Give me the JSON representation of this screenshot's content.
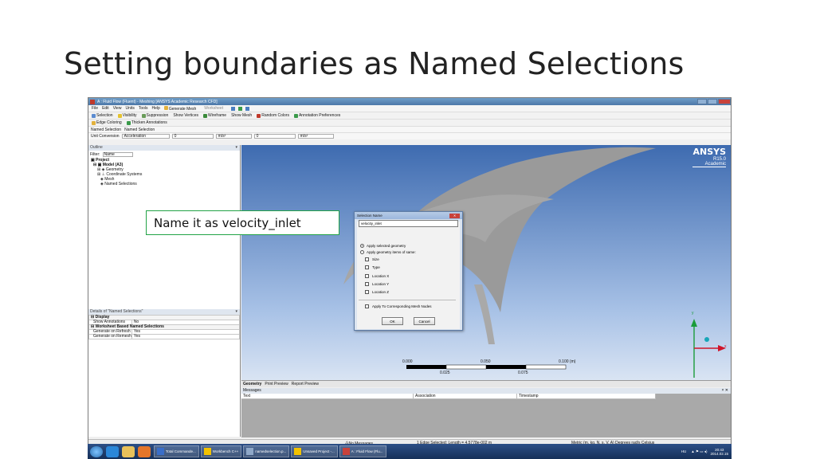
{
  "slide": {
    "title": "Setting boundaries as Named Selections"
  },
  "app": {
    "window_title": "A : Fluid Flow (Fluent) - Meshing [ANSYS Academic Research CFD]",
    "menu": [
      "File",
      "Edit",
      "View",
      "Units",
      "Tools",
      "Help"
    ],
    "toolbar1": [
      "Generate Mesh",
      "Worksheet"
    ],
    "toolbar2": [
      "Selection",
      "Visibility",
      "Suppression",
      "Show Vertices",
      "Wireframe",
      "Show Mesh",
      "Random Colors",
      "Annotation Preferences"
    ],
    "toolbar3": [
      "Edge Coloring",
      "Thicken Annotations"
    ],
    "named_selection_bar": [
      "Named Selection",
      "Named Selection"
    ],
    "unit_conversion": {
      "label": "Unit Conversion",
      "quantity": "Acceleration",
      "value1": "0",
      "unit1": "m/s²",
      "value2": "0",
      "unit2": "m/s²"
    }
  },
  "outline": {
    "header": "Outline",
    "filter_label": "Filter:",
    "filter_value": "Name",
    "tree": [
      "Project",
      "Model (A3)",
      "Geometry",
      "Coordinate Systems",
      "Mesh",
      "Named Selections"
    ]
  },
  "details": {
    "header": "Details of \"Named Selections\"",
    "rows": [
      {
        "name": "Display",
        "value": "",
        "group": true
      },
      {
        "name": "Show Annotations",
        "value": "No",
        "group": false
      },
      {
        "name": "Worksheet Based Named Selections",
        "value": "",
        "group": true
      },
      {
        "name": "Generate on Refresh",
        "value": "Yes",
        "group": false
      },
      {
        "name": "Generate on Remesh",
        "value": "Yes",
        "group": false
      }
    ]
  },
  "viewport": {
    "brand": "ANSYS",
    "release": "R15.0",
    "edition": "Academic",
    "axis_x": "x",
    "axis_y": "y",
    "scale_top": [
      "0.000",
      "0.050",
      "0.100 (m)"
    ],
    "scale_bottom": [
      "0.025",
      "0.075"
    ]
  },
  "tabs": [
    "Geometry",
    "Print Preview",
    "Report Preview"
  ],
  "messages": {
    "header": "Messages",
    "columns": [
      "Text",
      "Association",
      "Timestamp"
    ]
  },
  "status": {
    "messages": "No Messages",
    "selection": "1 Edge Selected: Length = 4.5778e-002 m",
    "units": "Metric (m, kg, N, s, V, A)  Degrees  rad/s  Celsius"
  },
  "dialog": {
    "title": "Selection Name",
    "input_value": "velocity_inlet",
    "radio1": "Apply selected geometry",
    "radio2": "Apply geometry items of same:",
    "checks": [
      "Size",
      "Type",
      "Location X",
      "Location Y",
      "Location Z"
    ],
    "mesh_check": "Apply To Corresponding Mesh Nodes",
    "ok": "OK",
    "cancel": "Cancel"
  },
  "callout": "Name it as velocity_inlet",
  "taskbar": {
    "tasks": [
      "Total Commande...",
      "Workbench C++",
      "namedselection.p...",
      "Unsaved Project -...",
      "A : Fluid Flow (Flu..."
    ],
    "lang": "HU",
    "time": "20:43",
    "date": "2014.02.15"
  },
  "colors": {
    "viewport_top": "#3e6bb0",
    "geometry": "#9a9a9a",
    "callout_border": "#22a346",
    "axis_y": "#1a9c3a",
    "axis_x": "#d0142a"
  }
}
